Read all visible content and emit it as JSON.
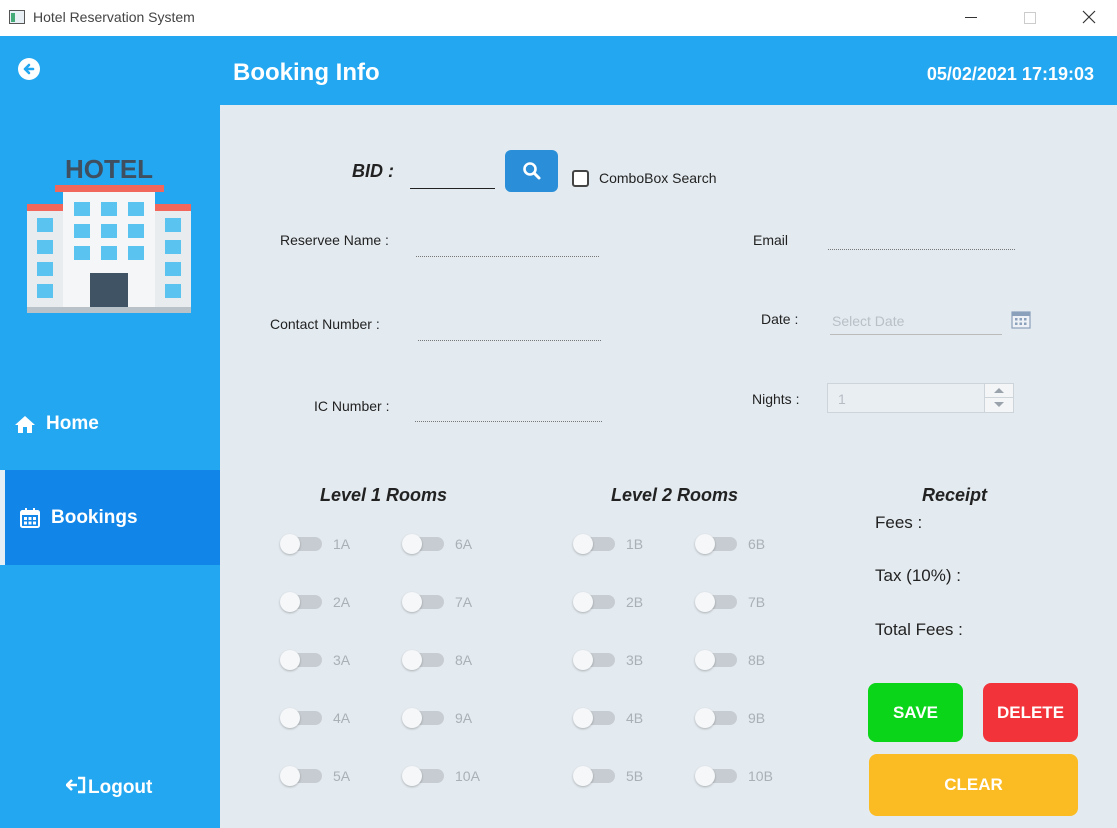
{
  "window": {
    "title": "Hotel Reservation System"
  },
  "header": {
    "title": "Booking Info",
    "datetime": "05/02/2021 17:19:03"
  },
  "sidebar": {
    "logo_text": "HOTEL",
    "items": [
      {
        "label": "Home",
        "icon": "home-icon"
      },
      {
        "label": "Bookings",
        "icon": "calendar-icon",
        "active": true
      }
    ],
    "logout_label": "Logout"
  },
  "form": {
    "bid_label": "BID :",
    "bid_value": "",
    "combobox_search_label": "ComboBox Search",
    "combobox_search_checked": false,
    "reservee_name_label": "Reservee Name :",
    "reservee_name_value": "",
    "email_label": "Email",
    "email_value": "",
    "contact_number_label": "Contact Number :",
    "contact_number_value": "",
    "date_label": "Date :",
    "date_placeholder": "Select Date",
    "ic_number_label": "IC Number :",
    "ic_number_value": "",
    "nights_label": "Nights :",
    "nights_value": "1"
  },
  "rooms": {
    "level1_title": "Level 1 Rooms",
    "level2_title": "Level 2 Rooms",
    "level1_col1": [
      "1A",
      "2A",
      "3A",
      "4A",
      "5A"
    ],
    "level1_col2": [
      "6A",
      "7A",
      "8A",
      "9A",
      "10A"
    ],
    "level2_col1": [
      "1B",
      "2B",
      "3B",
      "4B",
      "5B"
    ],
    "level2_col2": [
      "6B",
      "7B",
      "8B",
      "9B",
      "10B"
    ]
  },
  "receipt": {
    "title": "Receipt",
    "fees_label": "Fees :",
    "tax_label": "Tax (10%) :",
    "total_label": "Total Fees :"
  },
  "buttons": {
    "save": "SAVE",
    "delete": "DELETE",
    "clear": "CLEAR"
  },
  "colors": {
    "primary": "#22a7f0",
    "sidebar_active": "#1186e8",
    "save": "#0bd519",
    "delete": "#f2333a",
    "clear": "#fbbb22",
    "search_button": "#2a8fd8"
  }
}
